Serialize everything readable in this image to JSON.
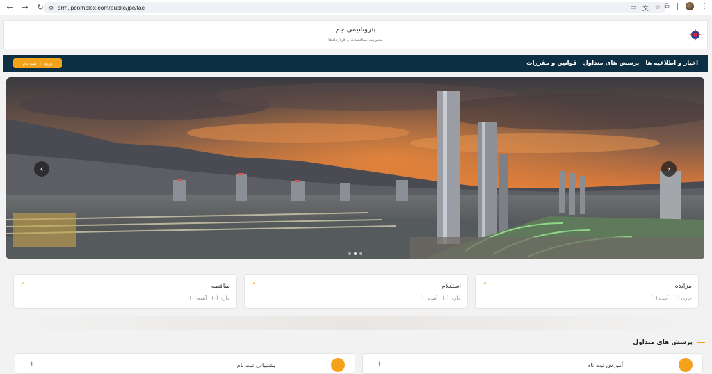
{
  "browser": {
    "url": "srm.jpcomplex.com/public/jpc/tac"
  },
  "header": {
    "title": "پتروشیمی جم",
    "subtitle": "مدیریت مناقصات و قراردادها"
  },
  "nav": {
    "links": [
      "اخبار و اطلاعیه ها",
      "پرسش های متداول",
      "قوانین و مقررات"
    ],
    "login_label": "ورود",
    "separator": "|",
    "register_label": "ثبت نام"
  },
  "cards": [
    {
      "title": "مزایده",
      "status": "جاری (۰) - آینده (۰)"
    },
    {
      "title": "استعلام",
      "status": "جاری (۰) - آینده (۰)"
    },
    {
      "title": "مناقصه",
      "status": "جاری (۰) - آینده (۰)"
    }
  ],
  "faq": {
    "title": "پرسش های متداول",
    "items": [
      {
        "label": "آموزش ثبت نام",
        "toggle": "+"
      },
      {
        "label": "پشتیبانی ثبت نام",
        "toggle": "+"
      }
    ]
  },
  "colors": {
    "accent": "#f5a21b",
    "navbar": "#0d2f44"
  }
}
